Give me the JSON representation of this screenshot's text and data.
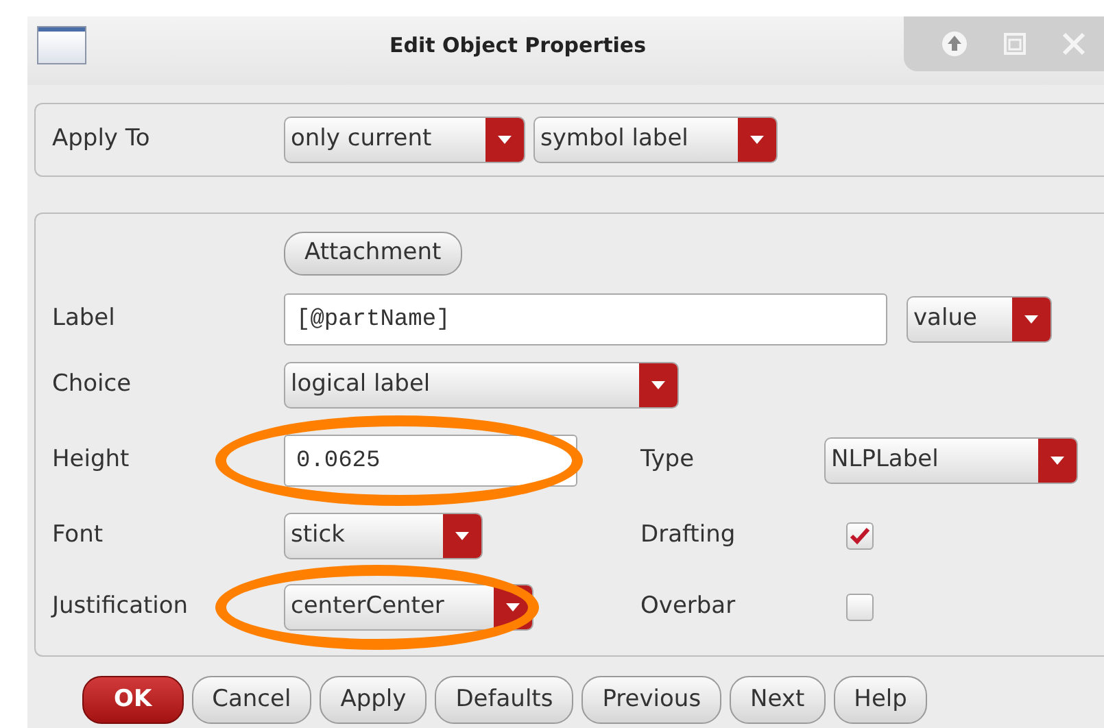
{
  "window": {
    "title": "Edit Object Properties"
  },
  "apply_to": {
    "label": "Apply To",
    "scope": "only current",
    "target": "symbol label"
  },
  "attachment_button": "Attachment",
  "fields": [
    {
      "kind": "text",
      "label": "Label",
      "value": "[@partName]",
      "mode": "value",
      "highlighted": false
    },
    {
      "kind": "select",
      "label": "Choice",
      "value": "logical label",
      "highlighted": false
    },
    {
      "kind": "text",
      "label": "Height",
      "value": "0.0625",
      "highlighted": true,
      "side": {
        "kind": "select",
        "label": "Type",
        "value": "NLPLabel"
      }
    },
    {
      "kind": "select",
      "label": "Font",
      "value": "stick",
      "highlighted": false,
      "side": {
        "kind": "check",
        "label": "Drafting",
        "checked": true
      }
    },
    {
      "kind": "select",
      "label": "Justification",
      "value": "centerCenter",
      "highlighted": true,
      "side": {
        "kind": "check",
        "label": "Overbar",
        "checked": false
      }
    }
  ],
  "buttons": [
    {
      "label": "OK",
      "default": true
    },
    {
      "label": "Cancel",
      "default": false
    },
    {
      "label": "Apply",
      "default": false
    },
    {
      "label": "Defaults",
      "default": false
    },
    {
      "label": "Previous",
      "default": false
    },
    {
      "label": "Next",
      "default": false
    },
    {
      "label": "Help",
      "default": false
    }
  ]
}
